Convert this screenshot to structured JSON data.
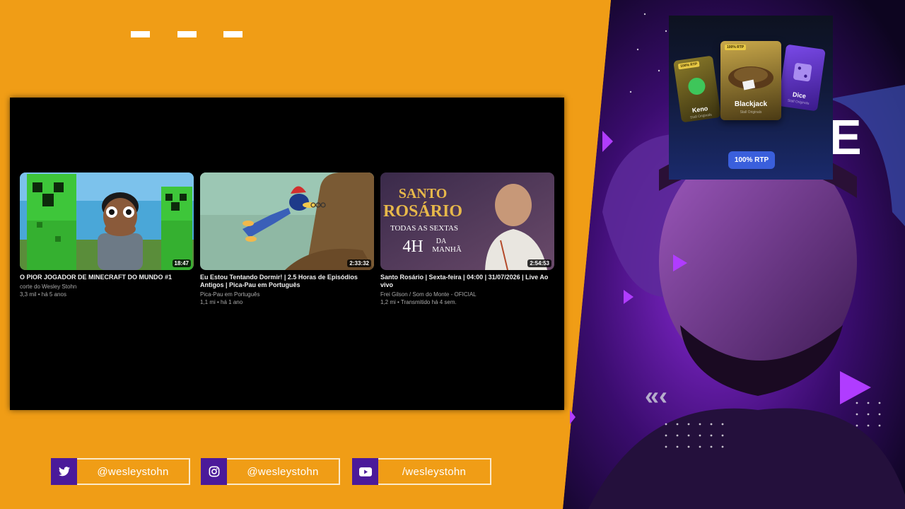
{
  "videos": [
    {
      "title": "O PIOR JOGADOR DE MINECRAFT DO MUNDO #1",
      "channel": "corte do Wesley Stohn",
      "meta": "3,3 mil • há 5 anos",
      "duration": "18:47"
    },
    {
      "title": "Eu Estou Tentando Dormir! | 2.5 Horas de Episódios Antigos | Pica-Pau em Português",
      "channel": "Pica-Pau em Português",
      "meta": "1,1 mi • há 1 ano",
      "duration": "2:33:32"
    },
    {
      "title": "Santo Rosário | Sexta-feira | 04:00 | 31/07/2026 | Live Ao vivo",
      "channel": "Frei Gilson / Som do Monte - OFICIAL",
      "meta": "1,2 mi • Transmitido há 4 sem.",
      "duration": "2:54:53",
      "thumb_text": {
        "line1": "SANTO",
        "line2": "ROSÁRIO",
        "line3": "TODAS AS SEXTAS",
        "line4": "4H",
        "line5": "DA",
        "line6": "MANHÃ"
      }
    }
  ],
  "social": [
    {
      "icon": "twitter-icon",
      "handle": "@wesleystohn"
    },
    {
      "icon": "instagram-icon",
      "handle": "@wesleystohn"
    },
    {
      "icon": "youtube-icon",
      "handle": "/wesleystohn"
    }
  ],
  "casino": {
    "cards": [
      {
        "name": "Keno",
        "sub": "Stall Originals",
        "badge": "100% RTP"
      },
      {
        "name": "Blackjack",
        "sub": "Stall Originals",
        "badge": "100% RTP"
      },
      {
        "name": "Dice",
        "sub": "Stall Originals",
        "badge": ""
      }
    ],
    "rtp_label": "100% RTP"
  },
  "colors": {
    "background": "#f09d16",
    "social_icon_bg": "#4b1a9a",
    "social_border": "#fbe9c9",
    "neon": "#b03cff"
  }
}
